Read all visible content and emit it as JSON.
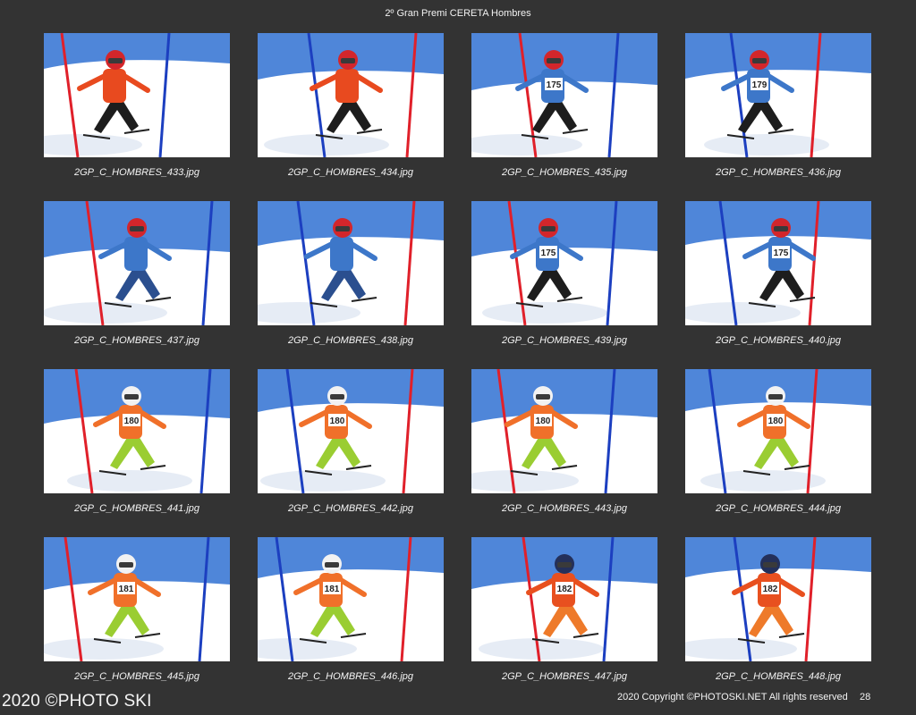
{
  "page": {
    "title": "2º Gran Premi CERETA Hombres",
    "footer_left": "2020 ©PHOTO SKI",
    "footer_right": "2020 Copyright ©PHOTOSKI.NET All rights reserved",
    "page_number": "28"
  },
  "colors": {
    "background": "#333333",
    "sky": "#4f86d9",
    "snow": "#ffffff",
    "gate_red": "#e0202a",
    "gate_blue": "#1c3fc0"
  },
  "photos": [
    {
      "filename": "2GP_C_HOMBRES_433.jpg",
      "bib": "",
      "helmet": "#d3262b",
      "jacket": "#e84a1f",
      "legs": "#1d1d1d"
    },
    {
      "filename": "2GP_C_HOMBRES_434.jpg",
      "bib": "",
      "helmet": "#d3262b",
      "jacket": "#e84a1f",
      "legs": "#1d1d1d"
    },
    {
      "filename": "2GP_C_HOMBRES_435.jpg",
      "bib": "175",
      "helmet": "#d3262b",
      "jacket": "#3d77c9",
      "legs": "#1d1d1d"
    },
    {
      "filename": "2GP_C_HOMBRES_436.jpg",
      "bib": "179",
      "helmet": "#d3262b",
      "jacket": "#3d77c9",
      "legs": "#1d1d1d"
    },
    {
      "filename": "2GP_C_HOMBRES_437.jpg",
      "bib": "",
      "helmet": "#d3262b",
      "jacket": "#3d77c9",
      "legs": "#2b4f8f"
    },
    {
      "filename": "2GP_C_HOMBRES_438.jpg",
      "bib": "",
      "helmet": "#d3262b",
      "jacket": "#3d77c9",
      "legs": "#2b4f8f"
    },
    {
      "filename": "2GP_C_HOMBRES_439.jpg",
      "bib": "175",
      "helmet": "#d3262b",
      "jacket": "#3d77c9",
      "legs": "#1d1d1d"
    },
    {
      "filename": "2GP_C_HOMBRES_440.jpg",
      "bib": "175",
      "helmet": "#d3262b",
      "jacket": "#3d77c9",
      "legs": "#1d1d1d"
    },
    {
      "filename": "2GP_C_HOMBRES_441.jpg",
      "bib": "180",
      "helmet": "#f2f2f2",
      "jacket": "#f0702a",
      "legs": "#9acd32"
    },
    {
      "filename": "2GP_C_HOMBRES_442.jpg",
      "bib": "180",
      "helmet": "#f2f2f2",
      "jacket": "#f0702a",
      "legs": "#9acd32"
    },
    {
      "filename": "2GP_C_HOMBRES_443.jpg",
      "bib": "180",
      "helmet": "#f2f2f2",
      "jacket": "#f0702a",
      "legs": "#9acd32"
    },
    {
      "filename": "2GP_C_HOMBRES_444.jpg",
      "bib": "180",
      "helmet": "#f2f2f2",
      "jacket": "#f0702a",
      "legs": "#9acd32"
    },
    {
      "filename": "2GP_C_HOMBRES_445.jpg",
      "bib": "181",
      "helmet": "#f2f2f2",
      "jacket": "#f0702a",
      "legs": "#9acd32"
    },
    {
      "filename": "2GP_C_HOMBRES_446.jpg",
      "bib": "181",
      "helmet": "#f2f2f2",
      "jacket": "#f0702a",
      "legs": "#9acd32"
    },
    {
      "filename": "2GP_C_HOMBRES_447.jpg",
      "bib": "182",
      "helmet": "#24305a",
      "jacket": "#e8501f",
      "legs": "#ee7a2a"
    },
    {
      "filename": "2GP_C_HOMBRES_448.jpg",
      "bib": "182",
      "helmet": "#24305a",
      "jacket": "#e8501f",
      "legs": "#ee7a2a"
    }
  ]
}
